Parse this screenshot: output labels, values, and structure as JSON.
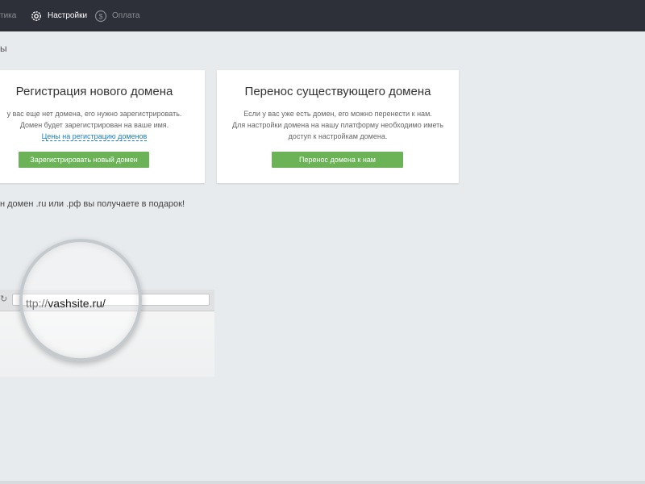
{
  "nav": {
    "items": [
      {
        "label": "тика",
        "icon": "chart-icon",
        "active": false
      },
      {
        "label": "Настройки",
        "icon": "gear-icon",
        "active": true
      },
      {
        "label": "Оплата",
        "icon": "dollar-circle-icon",
        "active": false
      }
    ]
  },
  "section_title": "ы",
  "cards": {
    "register": {
      "title": "Регистрация нового домена",
      "desc_line1": "у вас еще нет домена, его нужно зарегистрировать.",
      "desc_line2": "Домен будет зарегистрирован на ваше имя.",
      "link": "Цены на регистрацию доменов",
      "button": "Зарегистрировать новый домен"
    },
    "transfer": {
      "title": "Перенос существующего домена",
      "desc_line1": "Если у вас уже есть домен, его можно перенести к нам.",
      "desc_line2": "Для настройки домена на нашу платформу необходимо иметь",
      "desc_line3": "доступ к настройкам домена.",
      "button": "Перенос домена к нам"
    }
  },
  "gift_note": "н домен .ru или .рф вы получаете в подарок!",
  "illustration": {
    "url_protocol": "ttp://",
    "url_domain": "vashsite.ru/"
  },
  "colors": {
    "topbar": "#2d3038",
    "accent_button": "#6bb356",
    "link": "#1a7fc1",
    "background": "#e8ebee"
  }
}
